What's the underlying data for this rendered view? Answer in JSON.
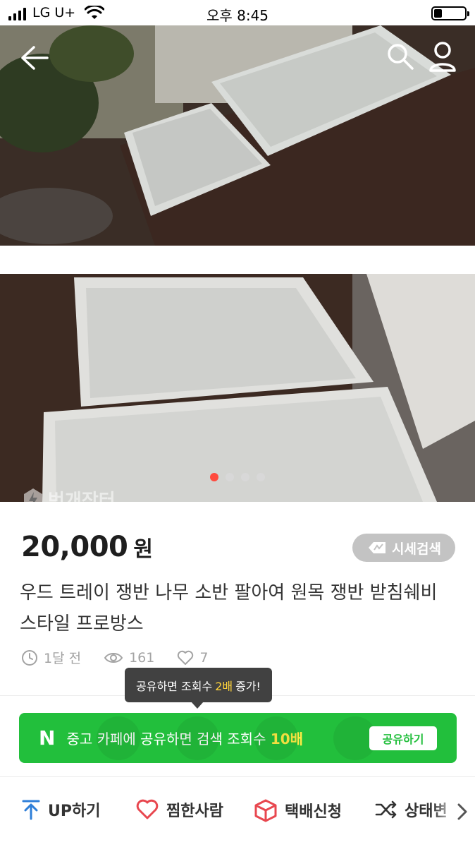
{
  "status_bar": {
    "carrier": "LG U+",
    "time": "오후 8:45",
    "battery_level": 0.25
  },
  "gallery": {
    "watermark": "번개장터",
    "page_count": 4,
    "active_page": 1
  },
  "product": {
    "price": "20,000",
    "currency": "원",
    "market_price_label": "시세검색",
    "title": "우드 트레이 쟁반 나무 소반 팔아여 원목 쟁반 받침쉐비 스타일 프로방스",
    "time_ago": "1달 전",
    "views": "161",
    "likes": "7"
  },
  "tooltip": {
    "prefix": "공유하면 조회수",
    "highlight": "2배",
    "suffix": "증가!"
  },
  "share_banner": {
    "logo": "N",
    "text_prefix": "중고 카페에 공유하면 검색 조회수",
    "text_highlight": "10배",
    "button_label": "공유하기"
  },
  "actions": {
    "up_label": "UP하기",
    "wish_label": "찜한사람",
    "delivery_label": "택배신청",
    "status_label": "상태변"
  },
  "colors": {
    "accent_red": "#ff4a3e",
    "naver_green": "#22bf3c",
    "highlight_yellow": "#ffd43b",
    "up_blue": "#2f7fd8",
    "heart_red": "#e8474f"
  }
}
